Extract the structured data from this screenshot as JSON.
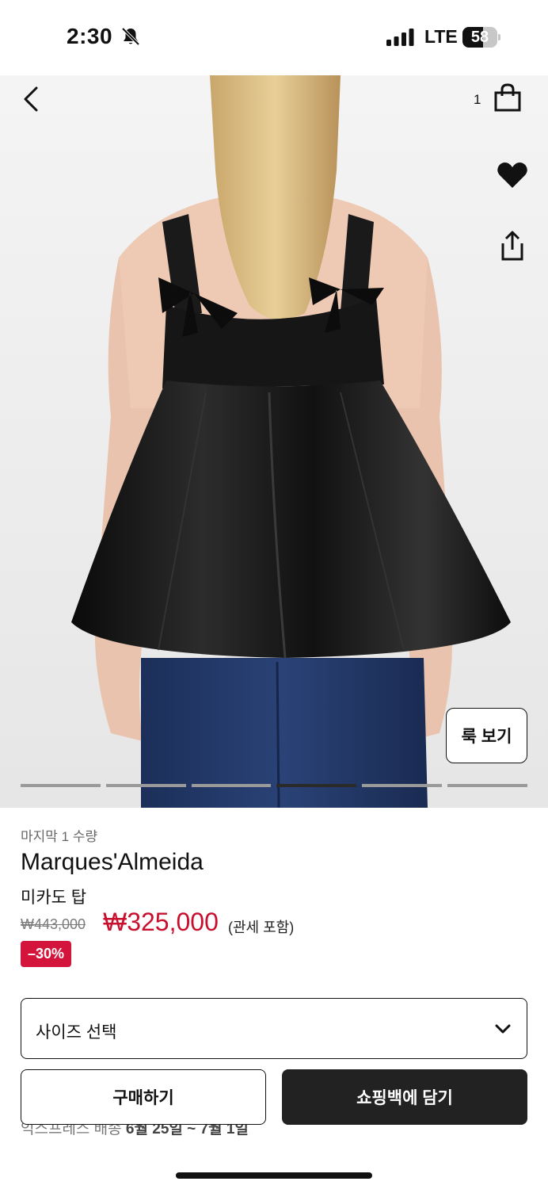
{
  "status_bar": {
    "time": "2:30",
    "network": "LTE",
    "battery_level": "58",
    "battery_fraction": 0.58
  },
  "header": {
    "bag_count": "1",
    "icons": [
      "chevron-left-icon",
      "shopping-bag-icon",
      "heart-icon",
      "share-icon"
    ]
  },
  "gallery": {
    "look_button_label": "룩 보기",
    "image_count": 6,
    "active_index": 3
  },
  "product": {
    "stock_note": "마지막 1 수량",
    "brand": "Marques'Almeida",
    "name": "미카도 탑",
    "original_price": "₩443,000",
    "sale_price": "₩325,000",
    "tax_note": "(관세 포함)",
    "discount": "–30%"
  },
  "size_selector": {
    "label": "사이즈 선택"
  },
  "actions": {
    "buy_label": "구매하기",
    "add_to_bag_label": "쇼핑백에 담기"
  },
  "delivery": {
    "prefix": "익스프레스 배송",
    "dates": "6월 25일 ~ 7월 1일"
  },
  "colors": {
    "sale_red": "#c8102e",
    "badge_red": "#d3153c",
    "primary_dark": "#222222"
  }
}
